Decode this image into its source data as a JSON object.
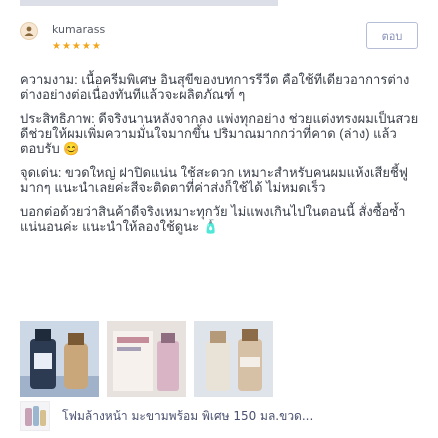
{
  "review": {
    "username": "kumarass",
    "stars": "★★★★★",
    "reply_label": "ตอบ",
    "paragraphs": [
      "ความงาม: เนื้อครีมพิเศษ อินสุขีของบทการรีวีต คือใช้ทีเดียวอาการต่างต่างอย่างต่อเนื่องทันทีแล้วจะผลิตภัณฑ์ ๆ",
      "ประสิทธิภาพ: ดีจริงนานหลังจากลง แพ่งทุกอย่าง ช่วยแต่งทรงผมเป็นสวยดีช่วยให้ผมเพิ่มความมั่นใจมากขึ้น ปริมาณมากกว่าที่คาด (ล่าง) แล้วตอบรับ 😊",
      "จุดเด่น: ขวดใหญ่ ฝาปิดแน่น ใช้สะดวก เหมาะสำหรับคนผมแห้งเสียชี้ฟูมากๆ แนะนำเลยค่ะสีจะติดตาที่ค่าส่งก็ใช้ได้ ไม่หมดเร็ว",
      "บอกต่อด้วยว่าสินค้าดีจริงเหมาะทุกวัย ไม่แพงเกินไปในตอนนี้ สั่งซื้อซ้ำแน่นอนค่ะ แนะนำให้ลองใช้ดูนะ 🧴"
    ]
  },
  "product": {
    "name": "โฟมล้างหน้า มะขามพร้อม พิเศษ 150 มล.ขวด..."
  },
  "colors": {
    "star": "#f2a51a",
    "accent": "#8a93b8"
  }
}
